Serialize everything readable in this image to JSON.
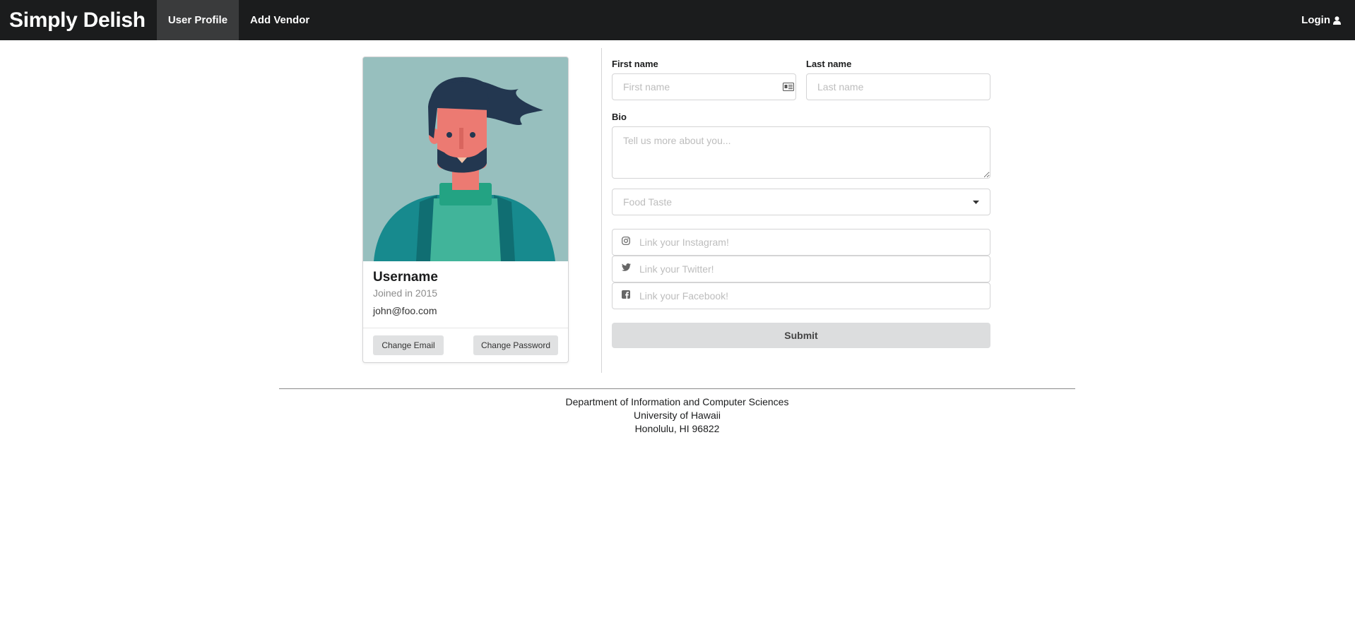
{
  "navbar": {
    "brand": "Simply Delish",
    "items": [
      {
        "label": "User Profile",
        "active": true
      },
      {
        "label": "Add Vendor",
        "active": false
      }
    ],
    "login_label": "Login",
    "login_icon": "user-icon"
  },
  "profile_card": {
    "avatar": "bearded-man-avatar-illustration",
    "username": "Username",
    "joined": "Joined in 2015",
    "email": "john@foo.com",
    "buttons": {
      "change_email": "Change Email",
      "change_password": "Change Password"
    }
  },
  "form": {
    "first_name": {
      "label": "First name",
      "placeholder": "First name",
      "value": "",
      "icon": "id-card-icon"
    },
    "last_name": {
      "label": "Last name",
      "placeholder": "Last name",
      "value": ""
    },
    "bio": {
      "label": "Bio",
      "placeholder": "Tell us more about you...",
      "value": ""
    },
    "food_taste": {
      "placeholder": "Food Taste",
      "icon": "caret-down-icon"
    },
    "social": [
      {
        "placeholder": "Link your Instagram!",
        "icon": "instagram-icon"
      },
      {
        "placeholder": "Link your Twitter!",
        "icon": "twitter-icon"
      },
      {
        "placeholder": "Link your Facebook!",
        "icon": "facebook-icon"
      }
    ],
    "submit_label": "Submit"
  },
  "footer": {
    "line1": "Department of Information and Computer Sciences",
    "line2": "University of Hawaii",
    "line3": "Honolulu, HI 96822"
  },
  "colors": {
    "navbar_bg": "#1b1c1d",
    "nav_active_bg": "#3a3b3c",
    "avatar_bg": "#97bfbe",
    "submit_bg": "#dcddde"
  }
}
